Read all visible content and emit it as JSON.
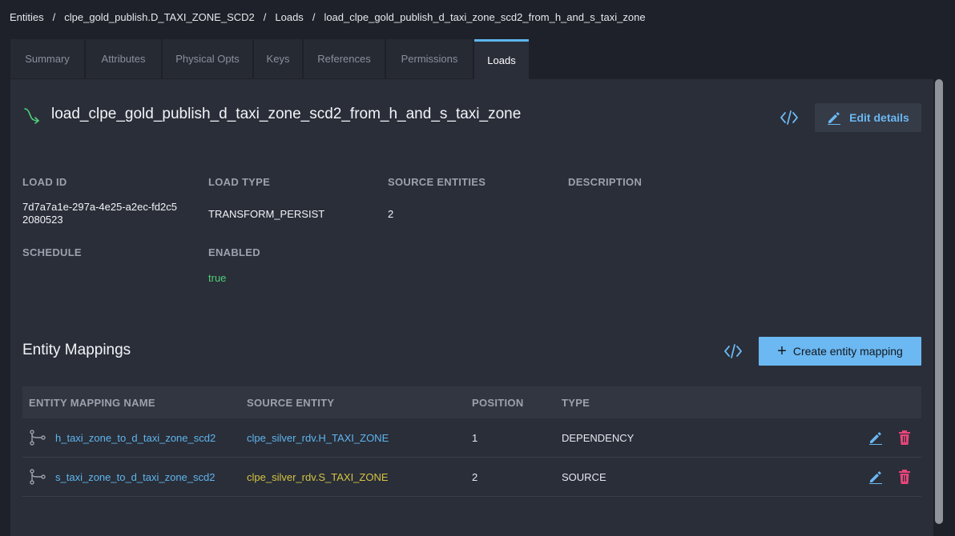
{
  "breadcrumb": [
    "Entities",
    "clpe_gold_publish.D_TAXI_ZONE_SCD2",
    "Loads",
    "load_clpe_gold_publish_d_taxi_zone_scd2_from_h_and_s_taxi_zone"
  ],
  "breadcrumb_separator": "/",
  "tabs": [
    {
      "label": "Summary",
      "active": false
    },
    {
      "label": "Attributes",
      "active": false
    },
    {
      "label": "Physical Opts",
      "active": false
    },
    {
      "label": "Keys",
      "active": false
    },
    {
      "label": "References",
      "active": false
    },
    {
      "label": "Permissions",
      "active": false
    },
    {
      "label": "Loads",
      "active": true
    }
  ],
  "load": {
    "title": "load_clpe_gold_publish_d_taxi_zone_scd2_from_h_and_s_taxi_zone",
    "edit_label": "Edit details",
    "fields": {
      "load_id_label": "LOAD ID",
      "load_id_value_1": "7d7a7a1e-297a-4e25-a2ec-fd2c5",
      "load_id_value_2": "2080523",
      "load_type_label": "LOAD TYPE",
      "load_type_value": "TRANSFORM_PERSIST",
      "source_entities_label": "SOURCE ENTITIES",
      "source_entities_value": "2",
      "description_label": "DESCRIPTION",
      "schedule_label": "SCHEDULE",
      "enabled_label": "ENABLED",
      "enabled_value": "true"
    }
  },
  "mappings": {
    "title": "Entity Mappings",
    "create_label": "Create entity mapping",
    "columns": [
      "ENTITY MAPPING NAME",
      "SOURCE ENTITY",
      "POSITION",
      "TYPE"
    ],
    "rows": [
      {
        "name": "h_taxi_zone_to_d_taxi_zone_scd2",
        "source": "clpe_silver_rdv.H_TAXI_ZONE",
        "position": "1",
        "type": "DEPENDENCY"
      },
      {
        "name": "s_taxi_zone_to_d_taxi_zone_scd2",
        "source": "clpe_silver_rdv.S_TAXI_ZONE",
        "position": "2",
        "type": "SOURCE"
      }
    ]
  },
  "colors": {
    "background": "#1e2129",
    "panel": "#2a2e38",
    "accent": "#5eb5f0",
    "enabled_green": "#4fcf78",
    "source_yellow": "#d4c443",
    "delete_red": "#e8457a"
  }
}
